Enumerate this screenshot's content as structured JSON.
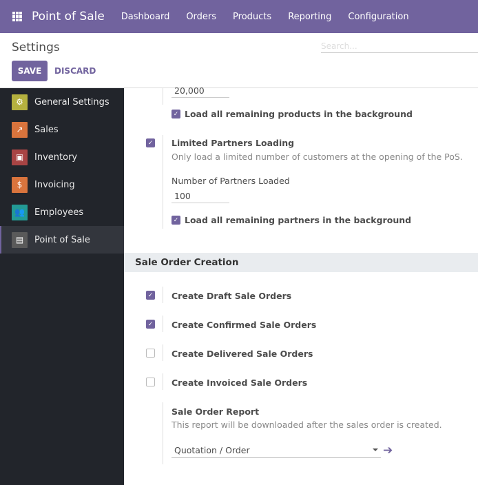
{
  "nav": {
    "brand": "Point of Sale",
    "menu": [
      "Dashboard",
      "Orders",
      "Products",
      "Reporting",
      "Configuration"
    ]
  },
  "control": {
    "title": "Settings",
    "search_placeholder": "Search...",
    "save": "SAVE",
    "discard": "DISCARD"
  },
  "sidebar": {
    "items": [
      {
        "label": "General Settings",
        "icon": "gear-icon",
        "color": "#b5b13f"
      },
      {
        "label": "Sales",
        "icon": "chart-icon",
        "color": "#d9743d"
      },
      {
        "label": "Inventory",
        "icon": "box-icon",
        "color": "#a84444"
      },
      {
        "label": "Invoicing",
        "icon": "invoice-icon",
        "color": "#d9743d"
      },
      {
        "label": "Employees",
        "icon": "users-icon",
        "color": "#239a95"
      },
      {
        "label": "Point of Sale",
        "icon": "store-icon",
        "color": "#5a5a5a",
        "active": true
      }
    ]
  },
  "content": {
    "products_loaded_value": "20,000",
    "load_remaining_products": "Load all remaining products in the background",
    "limited_partners": {
      "label": "Limited Partners Loading",
      "desc": "Only load a limited number of customers at the opening of the PoS.",
      "number_label": "Number of Partners Loaded",
      "number_value": "100",
      "load_remaining": "Load all remaining partners in the background"
    },
    "section_title": "Sale Order Creation",
    "options": [
      {
        "label": "Create Draft Sale Orders",
        "checked": true
      },
      {
        "label": "Create Confirmed Sale Orders",
        "checked": true
      },
      {
        "label": "Create Delivered Sale Orders",
        "checked": false
      },
      {
        "label": "Create Invoiced Sale Orders",
        "checked": false
      }
    ],
    "report": {
      "label": "Sale Order Report",
      "desc": "This report will be downloaded after the sales order is created.",
      "value": "Quotation / Order"
    }
  },
  "colors": {
    "accent": "#71639e",
    "sidebar": "#22252b"
  }
}
